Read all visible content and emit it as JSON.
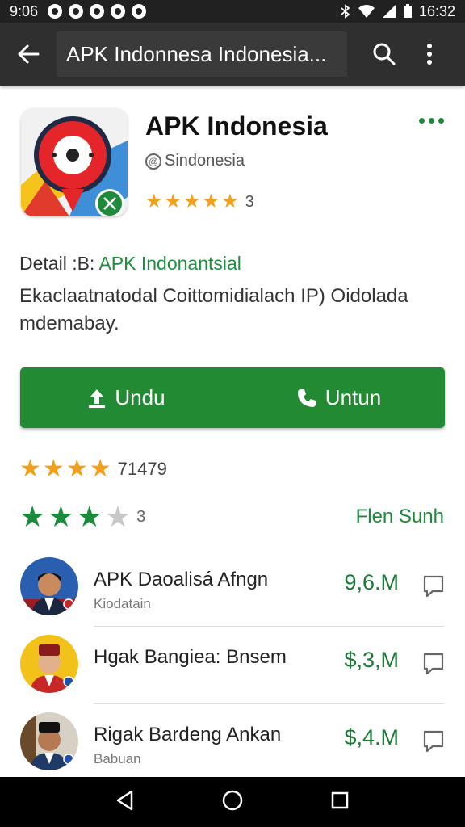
{
  "status_bar": {
    "time": "9:06",
    "clock": "16:32"
  },
  "toolbar": {
    "search_text": "APK Indonnesa Indonesia..."
  },
  "app": {
    "title": "APK Indonesia",
    "developer": "Sindonesia",
    "stars": 5,
    "rating_count": "3"
  },
  "detail": {
    "label": "Detail :B:",
    "value": "APK Indonantsial",
    "description": "Ekaclaatnatodal Coittomidialach IP) Oidolada mdemabay."
  },
  "actions": {
    "download_label": "Undu",
    "call_label": "Untun"
  },
  "rating_summary": {
    "stars": 4,
    "count": "71479"
  },
  "rating_secondary": {
    "count": "3",
    "link_label": "Flen Sunh"
  },
  "list": [
    {
      "name": "APK Daoalisá Afngn",
      "sub": "Kiodatain",
      "price": "9,6.M"
    },
    {
      "name": "Hgak Bangiea: Bnsem",
      "sub": "",
      "price": "$,3,M"
    },
    {
      "name": "Rigak Bardeng Ankan",
      "sub": "Babuan",
      "price": "$,4.M"
    }
  ],
  "colors": {
    "accent": "#238a34",
    "toolbar": "#2f2f2f",
    "star": "#f2a01c"
  }
}
